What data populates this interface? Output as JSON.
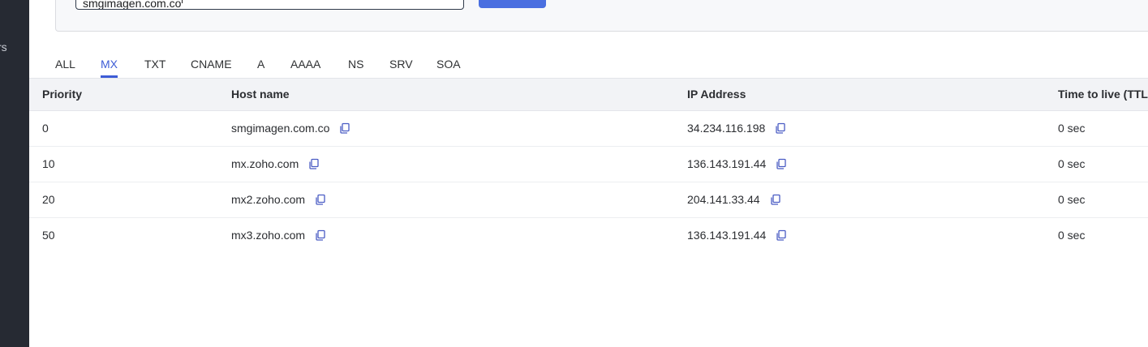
{
  "sidebar": {
    "partial_label": "rs"
  },
  "search": {
    "value": "smgimagen.com.co",
    "button_label": ""
  },
  "tabs": [
    {
      "label": "ALL",
      "active": false
    },
    {
      "label": "MX",
      "active": true
    },
    {
      "label": "TXT",
      "active": false
    },
    {
      "label": "CNAME",
      "active": false
    },
    {
      "label": "A",
      "active": false
    },
    {
      "label": "AAAA",
      "active": false
    },
    {
      "label": "NS",
      "active": false
    },
    {
      "label": "SRV",
      "active": false
    },
    {
      "label": "SOA",
      "active": false
    }
  ],
  "table": {
    "headers": {
      "priority": "Priority",
      "host": "Host name",
      "ip": "IP Address",
      "ttl": "Time to live (TTL)"
    },
    "rows": [
      {
        "priority": "0",
        "host": "smgimagen.com.co",
        "ip": "34.234.116.198",
        "ttl": "0 sec"
      },
      {
        "priority": "10",
        "host": "mx.zoho.com",
        "ip": "136.143.191.44",
        "ttl": "0 sec"
      },
      {
        "priority": "20",
        "host": "mx2.zoho.com",
        "ip": "204.141.33.44",
        "ttl": "0 sec"
      },
      {
        "priority": "50",
        "host": "mx3.zoho.com",
        "ip": "136.143.191.44",
        "ttl": "0 sec"
      }
    ]
  },
  "colors": {
    "accent": "#3d5cd6",
    "button": "#4a6fe0",
    "sidebar": "#262a33",
    "header_bg": "#f2f3f6"
  }
}
